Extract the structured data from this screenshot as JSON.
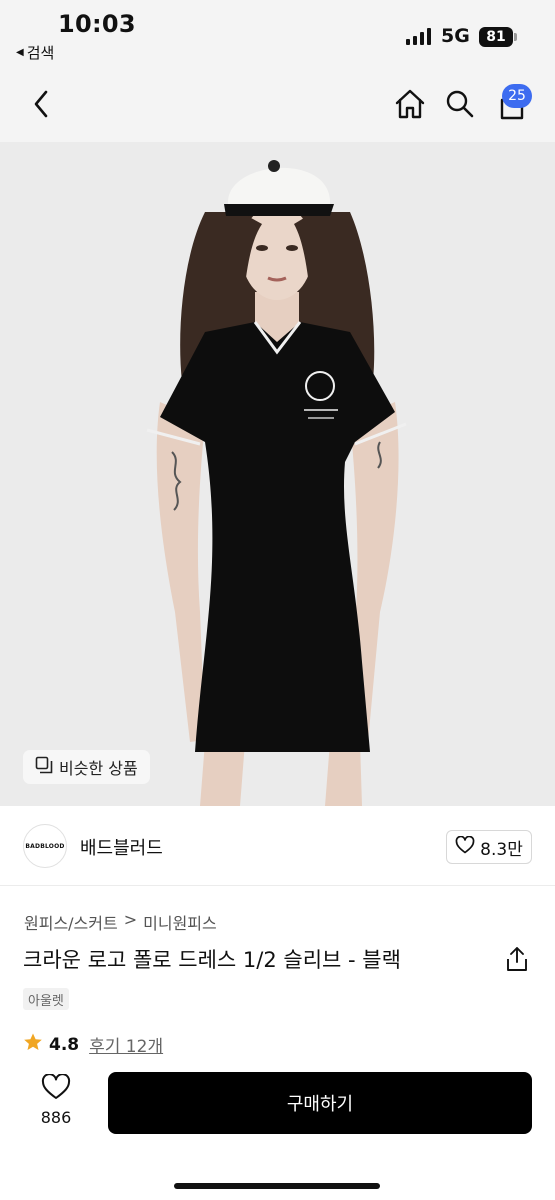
{
  "status_bar": {
    "time": "10:03",
    "back_app_label": "검색",
    "network": "5G",
    "battery": "81"
  },
  "nav": {
    "cart_count": "25",
    "icons": [
      "back-icon",
      "home-icon",
      "search-icon",
      "cart-icon"
    ]
  },
  "hero": {
    "similar_products_label": "비슷한 상품"
  },
  "brand": {
    "logo_text": "BADBLOOD",
    "name": "배드블러드",
    "like_count": "8.3만"
  },
  "product": {
    "breadcrumb": [
      "원피스/스커트",
      ">",
      "미니원피스"
    ],
    "title": "크라운 로고 폴로 드레스 1/2 슬리브 - 블랙",
    "tag": "아울렛",
    "rating": "4.8",
    "reviews_label": "후기 12개"
  },
  "bottom_bar": {
    "like_count": "886",
    "buy_label": "구매하기"
  },
  "colors": {
    "accent_badge": "#3d6cf0",
    "star": "#f0a623",
    "buy_button": "#000000"
  }
}
